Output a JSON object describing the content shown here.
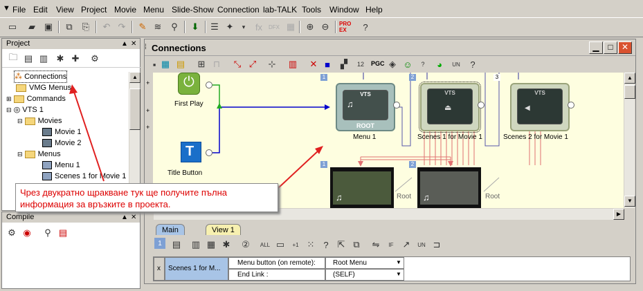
{
  "menu": {
    "items": [
      "File",
      "Edit",
      "View",
      "Project",
      "Movie",
      "Menu",
      "Slide-Show",
      "Connection",
      "lab-TALK",
      "Tools",
      "Window",
      "Help"
    ]
  },
  "project": {
    "title": "Project",
    "tree": [
      {
        "label": "Connections",
        "level": 0,
        "icon": "connections-icon"
      },
      {
        "label": "VMG Menus",
        "level": 0,
        "icon": "folder-icon"
      },
      {
        "label": "Commands",
        "level": 0,
        "icon": "folder-icon"
      },
      {
        "label": "VTS 1",
        "level": 0,
        "icon": "disc-icon"
      },
      {
        "label": "Movies",
        "level": 1,
        "icon": "folder-icon"
      },
      {
        "label": "Movie 1",
        "level": 2,
        "icon": "movie-icon"
      },
      {
        "label": "Movie 2",
        "level": 2,
        "icon": "movie-icon"
      },
      {
        "label": "Menus",
        "level": 1,
        "icon": "folder-icon"
      },
      {
        "label": "Menu 1",
        "level": 2,
        "icon": "menu-icon"
      },
      {
        "label": "Scenes 1 for Movie 1",
        "level": 2,
        "icon": "menu-icon"
      }
    ]
  },
  "compile": {
    "title": "Compile"
  },
  "connections": {
    "title": "Connections",
    "toolbar_pgc": "PGC",
    "nodes": {
      "first_play": "First Play",
      "title_button": "Title Button",
      "vts_tag": "VTS",
      "root_tag": "ROOT",
      "menu1": "Menu 1",
      "scenes1": "Scenes 1 for Movie 1",
      "scenes2": "Scenes 2 for Movie 1",
      "num1": "1",
      "num2": "2",
      "num3": "3",
      "root_right1": "Root",
      "root_right2": "Root"
    },
    "tabs": [
      "Main",
      "View 1"
    ],
    "bottom_num": "1",
    "props": {
      "x_label": "x",
      "item_label": "Scenes 1 for M...",
      "row1_key": "Menu button (on remote):",
      "row1_val": "Root Menu",
      "row2_key": "End Link :",
      "row2_val": "(SELF)"
    }
  },
  "callout": {
    "text": "Чрез двукратно щракване тук ще получите пълна информация за връзките в проекта."
  },
  "colors": {
    "accent": "#7ea0d4",
    "arrow_red": "#e02020",
    "canvas_bg": "#fefee0"
  }
}
